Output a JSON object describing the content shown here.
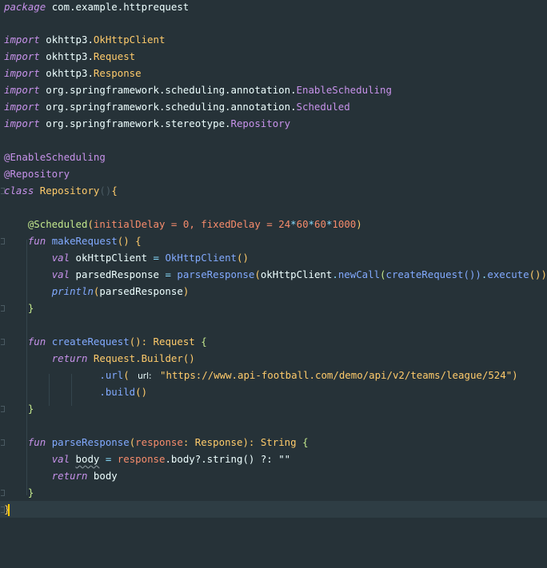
{
  "editor": {
    "package_line": {
      "keyword": "package",
      "name": "com.example.httprequest"
    },
    "imports": [
      {
        "keyword": "import",
        "path": "okhttp3.",
        "cls": "OkHttpClient"
      },
      {
        "keyword": "import",
        "path": "okhttp3.",
        "cls": "Request"
      },
      {
        "keyword": "import",
        "path": "okhttp3.",
        "cls": "Response"
      },
      {
        "keyword": "import",
        "path": "org.springframework.scheduling.annotation.",
        "cls": "EnableScheduling"
      },
      {
        "keyword": "import",
        "path": "org.springframework.scheduling.annotation.",
        "cls": "Scheduled"
      },
      {
        "keyword": "import",
        "path": "org.springframework.stereotype.",
        "cls": "Repository"
      }
    ],
    "annotations": [
      "@EnableScheduling",
      "@Repository"
    ],
    "class_line": {
      "keyword": "class",
      "name": "Repository",
      "parens": "()",
      "brace": "{"
    },
    "scheduled": {
      "name": "@Scheduled",
      "open": "(",
      "arg1": "initialDelay",
      "eq": " = ",
      "v1": "0",
      "comma": ", ",
      "arg2": "fixedDelay",
      "v2a": "24",
      "star": "*",
      "v2b": "60",
      "v2c": "60",
      "v2d": "1000",
      "close": ")"
    },
    "make_request": {
      "fun": "fun",
      "name": "makeRequest",
      "sig": "() {",
      "l1_val": "val",
      "l1_var": "okHttpClient",
      "l1_eq": " = ",
      "l1_call": "OkHttpClient",
      "l1_paren": "()",
      "l2_val": "val",
      "l2_var": "parsedResponse",
      "l2_eq": " = ",
      "l2_fn": "parseResponse",
      "l2_a": "(",
      "l2_obj": "okHttpClient",
      "l2_dot": ".",
      "l2_new": "newCall",
      "l2_b": "(",
      "l2_cr": "createRequest",
      "l2_c": "())",
      "l2_ex": "execute",
      "l2_d": "())",
      "l3_fn": "println",
      "l3_a": "(",
      "l3_arg": "parsedResponse",
      "l3_b": ")",
      "close": "}"
    },
    "create_request": {
      "fun": "fun",
      "name": "createRequest",
      "sig": "(): ",
      "ret_type": "Request",
      "brace": " {",
      "ret": "return",
      "builder_cls": "Request",
      "builder": ".Builder",
      "builder_paren": "()",
      "url_dot": ".url",
      "url_open": "( ",
      "url_hint": "url:",
      "url_value": "\"https://www.api-football.com/demo/api/v2/teams/league/524\"",
      "url_close": ")",
      "build_dot": ".build",
      "build_paren": "()",
      "close": "}"
    },
    "parse_response": {
      "fun": "fun",
      "name": "parseResponse",
      "open": "(",
      "param": "response",
      "colon": ": ",
      "param_type": "Response",
      "close_paren": "): ",
      "ret_type": "String",
      "brace": " {",
      "l1_val": "val",
      "l1_var": "body",
      "l1_eq": " = ",
      "l1_obj": "response",
      "l1_rest": ".body?.string() ?: ",
      "l1_str": "\"\"",
      "l2_ret": "return",
      "l2_var": "body",
      "close": "}"
    },
    "class_close": "}"
  }
}
